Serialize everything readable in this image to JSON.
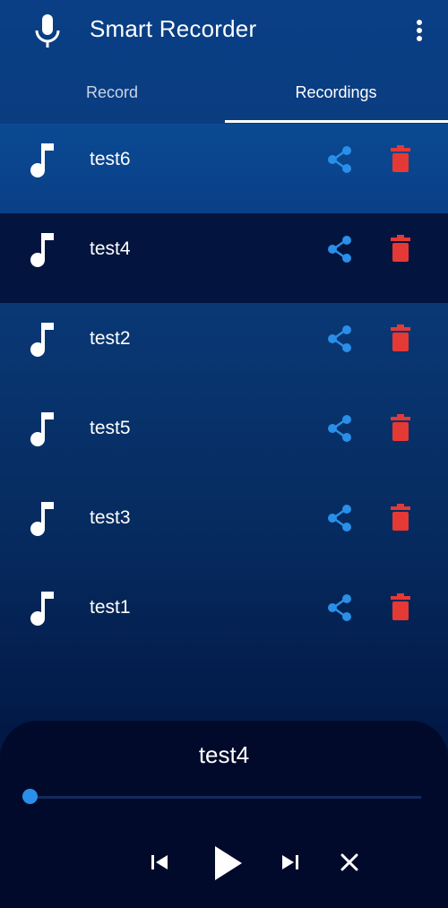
{
  "app": {
    "title": "Smart Recorder"
  },
  "icons": {
    "mic": "mic-icon",
    "more": "more-vert-icon",
    "note": "music-note-icon",
    "share": "share-icon",
    "delete": "trash-icon"
  },
  "colors": {
    "share": "#2a8fe8",
    "delete": "#e53935",
    "accent": "#2a8fe8",
    "selected_row": "#03143f"
  },
  "tabs": [
    {
      "label": "Record"
    },
    {
      "label": "Recordings"
    }
  ],
  "active_tab": "Recordings",
  "recordings": [
    {
      "name": "test6"
    },
    {
      "name": "test4"
    },
    {
      "name": "test2"
    },
    {
      "name": "test5"
    },
    {
      "name": "test3"
    },
    {
      "name": "test1"
    }
  ],
  "selected_recording": "test4",
  "player": {
    "now_playing": "test4",
    "progress": 0.0
  }
}
